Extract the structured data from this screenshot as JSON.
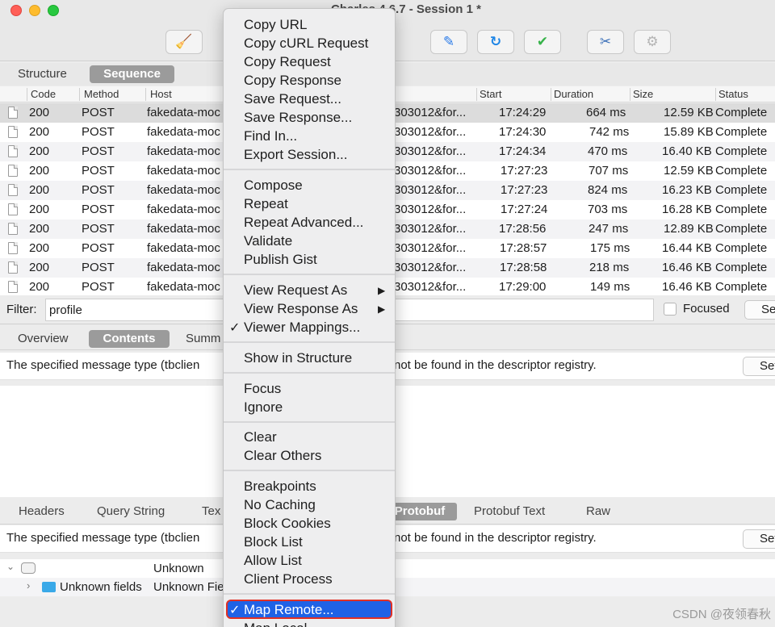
{
  "window": {
    "title": "Charles 4.6.7 - Session 1 *"
  },
  "toolbar": {
    "icons": [
      "broom-icon",
      "pen-icon",
      "refresh-icon",
      "check-icon",
      "tools-icon",
      "gear-icon"
    ]
  },
  "view_tabs": [
    "Structure",
    "Sequence"
  ],
  "table": {
    "columns": [
      "Code",
      "Method",
      "Host",
      "Start",
      "Duration",
      "Size",
      "Status"
    ],
    "rows": [
      {
        "code": "200",
        "method": "POST",
        "host": "fakedata-moc",
        "path": "303012&for...",
        "start": "17:24:29",
        "duration": "664 ms",
        "size": "12.59 KB",
        "status": "Complete"
      },
      {
        "code": "200",
        "method": "POST",
        "host": "fakedata-moc",
        "path": "303012&for...",
        "start": "17:24:30",
        "duration": "742 ms",
        "size": "15.89 KB",
        "status": "Complete"
      },
      {
        "code": "200",
        "method": "POST",
        "host": "fakedata-moc",
        "path": "303012&for...",
        "start": "17:24:34",
        "duration": "470 ms",
        "size": "16.40 KB",
        "status": "Complete"
      },
      {
        "code": "200",
        "method": "POST",
        "host": "fakedata-moc",
        "path": "303012&for...",
        "start": "17:27:23",
        "duration": "707 ms",
        "size": "12.59 KB",
        "status": "Complete"
      },
      {
        "code": "200",
        "method": "POST",
        "host": "fakedata-moc",
        "path": "303012&for...",
        "start": "17:27:23",
        "duration": "824 ms",
        "size": "16.23 KB",
        "status": "Complete"
      },
      {
        "code": "200",
        "method": "POST",
        "host": "fakedata-moc",
        "path": "303012&for...",
        "start": "17:27:24",
        "duration": "703 ms",
        "size": "16.28 KB",
        "status": "Complete"
      },
      {
        "code": "200",
        "method": "POST",
        "host": "fakedata-moc",
        "path": "303012&for...",
        "start": "17:28:56",
        "duration": "247 ms",
        "size": "12.89 KB",
        "status": "Complete"
      },
      {
        "code": "200",
        "method": "POST",
        "host": "fakedata-moc",
        "path": "303012&for...",
        "start": "17:28:57",
        "duration": "175 ms",
        "size": "16.44 KB",
        "status": "Complete"
      },
      {
        "code": "200",
        "method": "POST",
        "host": "fakedata-moc",
        "path": "303012&for...",
        "start": "17:28:58",
        "duration": "218 ms",
        "size": "16.46 KB",
        "status": "Complete"
      },
      {
        "code": "200",
        "method": "POST",
        "host": "fakedata-moc",
        "path": "303012&for...",
        "start": "17:29:00",
        "duration": "149 ms",
        "size": "16.46 KB",
        "status": "Complete"
      }
    ]
  },
  "filter": {
    "label": "Filter:",
    "value": "profile",
    "focused_label": "Focused",
    "settings_label": "Settings"
  },
  "detail_tabs": [
    "Overview",
    "Contents",
    "Summ"
  ],
  "message": {
    "left": "The specified message type (tbclien",
    "right": "not be found in the descriptor registry.",
    "settings_label": "Settings"
  },
  "body_tabs": [
    "Headers",
    "Query String",
    "Tex",
    "Protobuf",
    "Protobuf Text",
    "Raw"
  ],
  "tree": {
    "row1": {
      "value": "Unknown"
    },
    "row2": {
      "label": "Unknown fields",
      "value": "Unknown Fie"
    }
  },
  "context_menu": {
    "group1": [
      "Copy URL",
      "Copy cURL Request",
      "Copy Request",
      "Copy Response",
      "Save Request...",
      "Save Response...",
      "Find In...",
      "Export Session..."
    ],
    "group2": [
      "Compose",
      "Repeat",
      "Repeat Advanced...",
      "Validate",
      "Publish Gist"
    ],
    "group3": [
      "View Request As",
      "View Response As",
      "Viewer Mappings..."
    ],
    "group4": [
      "Show in Structure"
    ],
    "group5": [
      "Focus",
      "Ignore"
    ],
    "group6": [
      "Clear",
      "Clear Others"
    ],
    "group7": [
      "Breakpoints",
      "No Caching",
      "Block Cookies",
      "Block List",
      "Allow List",
      "Client Process"
    ],
    "group8": [
      "Map Remote...",
      "Map Local..."
    ],
    "checkmark": "✓"
  },
  "watermark": "CSDN @夜领春秋"
}
